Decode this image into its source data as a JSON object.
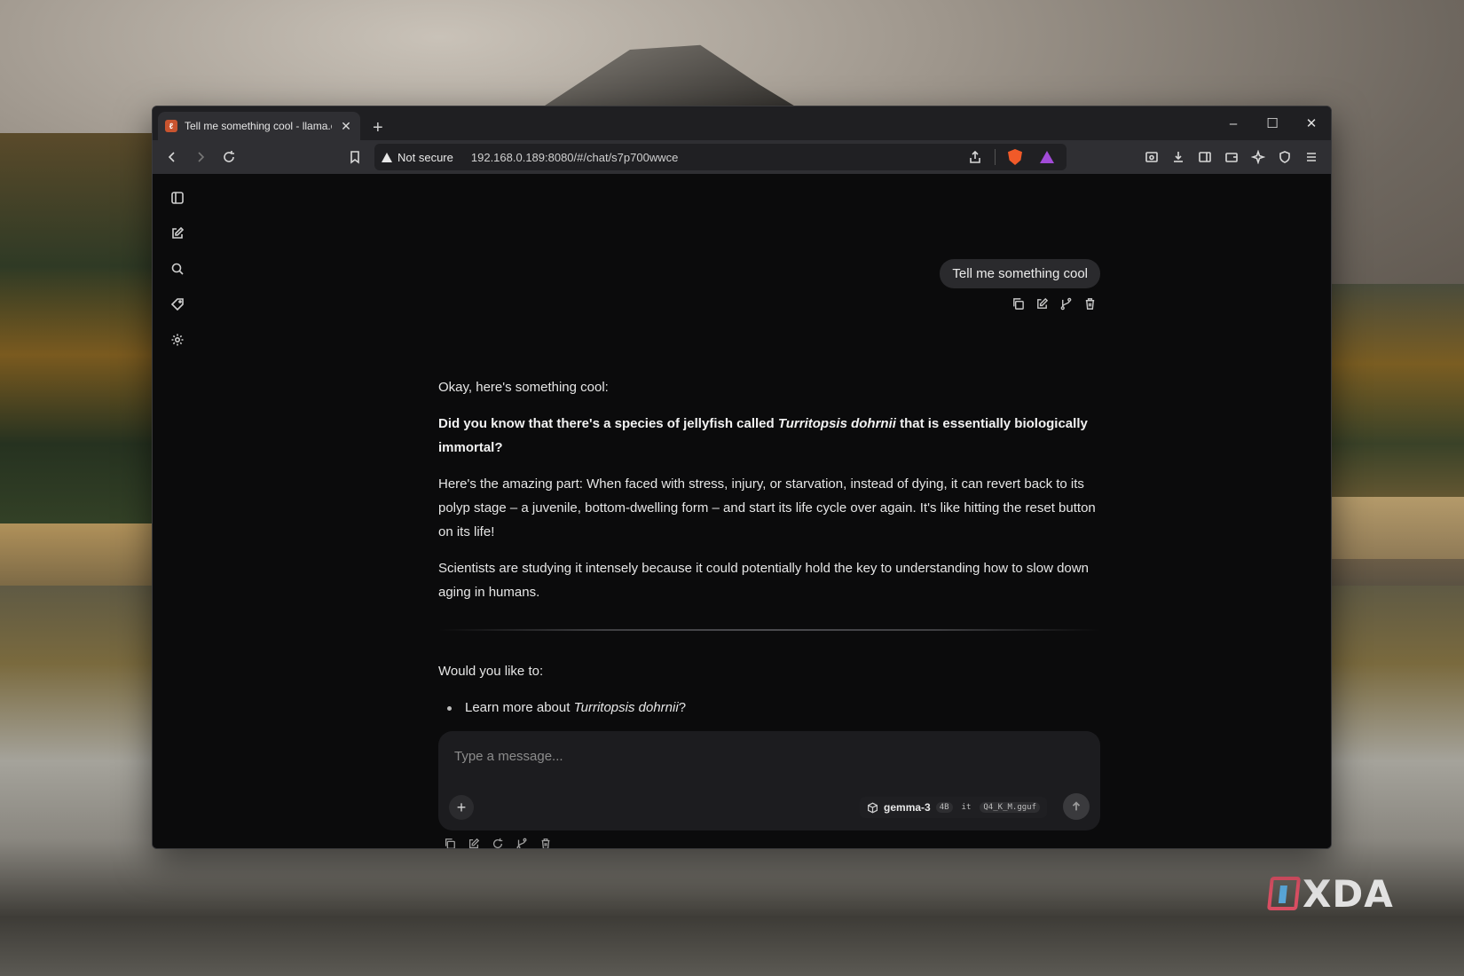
{
  "browser": {
    "tab": {
      "title": "Tell me something cool - llama.c",
      "favicon_icon": "llama-favicon"
    },
    "new_tab_label": "+",
    "window_controls": {
      "minimize": "–",
      "maximize": "☐",
      "close": "✕"
    },
    "security_label": "Not secure",
    "url": "192.168.0.189:8080/#/chat/s7p700wwce"
  },
  "chat": {
    "user_message": "Tell me something cool",
    "assistant": {
      "intro": "Okay, here's something cool:",
      "highlight_pre": "Did you know that there's a species of jellyfish called ",
      "highlight_species": "Turritopsis dohrnii",
      "highlight_post": " that is essentially biologically immortal?",
      "paragraph_1": "Here's the amazing part: When faced with stress, injury, or starvation, instead of dying, it can revert back to its polyp stage – a juvenile, bottom-dwelling form – and start its life cycle over again. It's like hitting the reset button on its life!",
      "paragraph_2": "Scientists are studying it intensely because it could potentially hold the key to understanding how to slow down aging in humans.",
      "followup": "Would you like to:",
      "bullet_1_pre": "Learn more about ",
      "bullet_1_species": "Turritopsis dohrnii",
      "bullet_1_post": "?"
    },
    "composer": {
      "placeholder": "Type a message...",
      "attach_label": "+",
      "model": {
        "name": "gemma-3",
        "tags": [
          "4B",
          "it",
          "Q4_K_M.gguf"
        ]
      }
    }
  },
  "watermark": "XDA"
}
